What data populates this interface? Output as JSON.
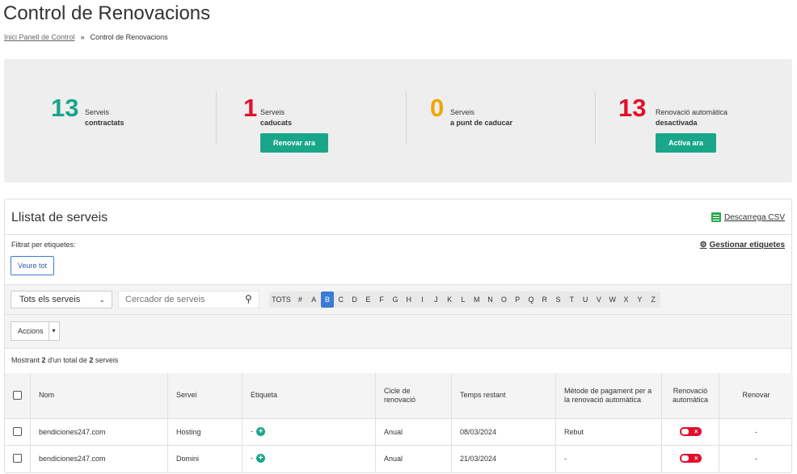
{
  "page": {
    "title": "Control de Renovacions",
    "breadcrumb": [
      {
        "label": "Inici Panell de Control"
      },
      {
        "label": "Control de Renovacions"
      }
    ],
    "breadcrumb_sep": "»"
  },
  "summary": {
    "stats": [
      {
        "number": "13",
        "label_top": "Serveis",
        "label_bottom": "contractats",
        "color": "#1aa68a"
      },
      {
        "number": "1",
        "label_top": "Serveis",
        "label_bottom": "caducats",
        "color": "#e0102c",
        "button": "Renovar ara"
      },
      {
        "number": "0",
        "label_top": "Serveis",
        "label_bottom": "a punt de caducar",
        "color": "#f0a500"
      },
      {
        "number": "13",
        "label_top": "Renovació automàtica",
        "label_bottom": "desactivada",
        "color": "#e0102c",
        "button": "Activa ara"
      }
    ]
  },
  "list": {
    "title": "Llistat de serveis",
    "csv_label": "Descarrega CSV",
    "filter_label": "Filtrat per etiquetes:",
    "manage_label": "Gestionar etiquetes",
    "view_all": "Veure tot",
    "select_value": "Tots els serveis",
    "search_placeholder": "Cercador de serveis",
    "letters": [
      "TOTS",
      "#",
      "A",
      "B",
      "C",
      "D",
      "E",
      "F",
      "G",
      "H",
      "I",
      "J",
      "K",
      "L",
      "M",
      "N",
      "O",
      "P",
      "Q",
      "R",
      "S",
      "T",
      "U",
      "V",
      "W",
      "X",
      "Y",
      "Z"
    ],
    "active_letter": "B",
    "actions_label": "Accions",
    "showing_prefix": "Mostrant",
    "showing_count": "2",
    "showing_mid": "d'un total de",
    "showing_total": "2",
    "showing_suffix": "serveis"
  },
  "table": {
    "headers": {
      "name": "Nom",
      "service": "Servei",
      "tag": "Etiqueta",
      "cycle": "Cicle de renovació",
      "remaining": "Temps restant",
      "payment": "Mètode de pagament per a la renovació automàtica",
      "auto": "Renovació automàtica",
      "renew": "Renovar"
    },
    "rows": [
      {
        "name": "bendiciones247.com",
        "service": "Hosting",
        "tag": "-",
        "cycle": "Anual",
        "remaining": "08/03/2024",
        "payment": "Rebut",
        "auto": false,
        "renew": "-"
      },
      {
        "name": "bendiciones247.com",
        "service": "Domini",
        "tag": "-",
        "cycle": "Anual",
        "remaining": "21/03/2024",
        "payment": "-",
        "auto": false,
        "renew": "-"
      }
    ]
  },
  "colors": {
    "accent": "#1aa68a",
    "danger": "#e0102c",
    "warning": "#f0a500",
    "link_blue": "#3a7bd5"
  }
}
